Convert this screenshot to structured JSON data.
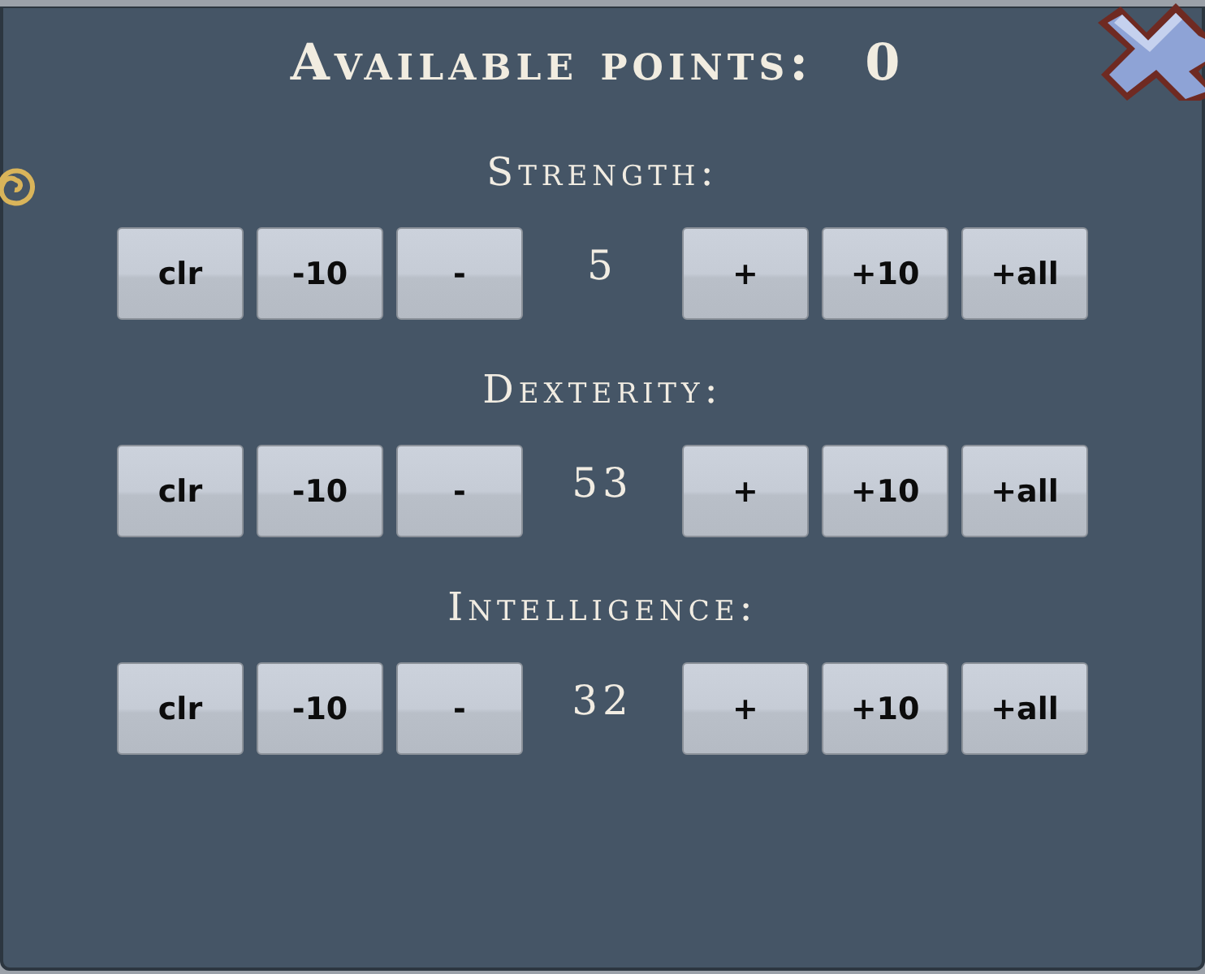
{
  "dialog": {
    "title": "Available points:",
    "points": "0"
  },
  "stats": [
    {
      "name": "Strength:",
      "value": "5",
      "minus_buttons": [
        "clr",
        "-10",
        "-"
      ],
      "plus_buttons": [
        "+",
        "+10",
        "+all"
      ]
    },
    {
      "name": "Dexterity:",
      "value": "53",
      "minus_buttons": [
        "clr",
        "-10",
        "-"
      ],
      "plus_buttons": [
        "+",
        "+10",
        "+all"
      ]
    },
    {
      "name": "Intelligence:",
      "value": "32",
      "minus_buttons": [
        "clr",
        "-10",
        "-"
      ],
      "plus_buttons": [
        "+",
        "+10",
        "+all"
      ]
    }
  ]
}
